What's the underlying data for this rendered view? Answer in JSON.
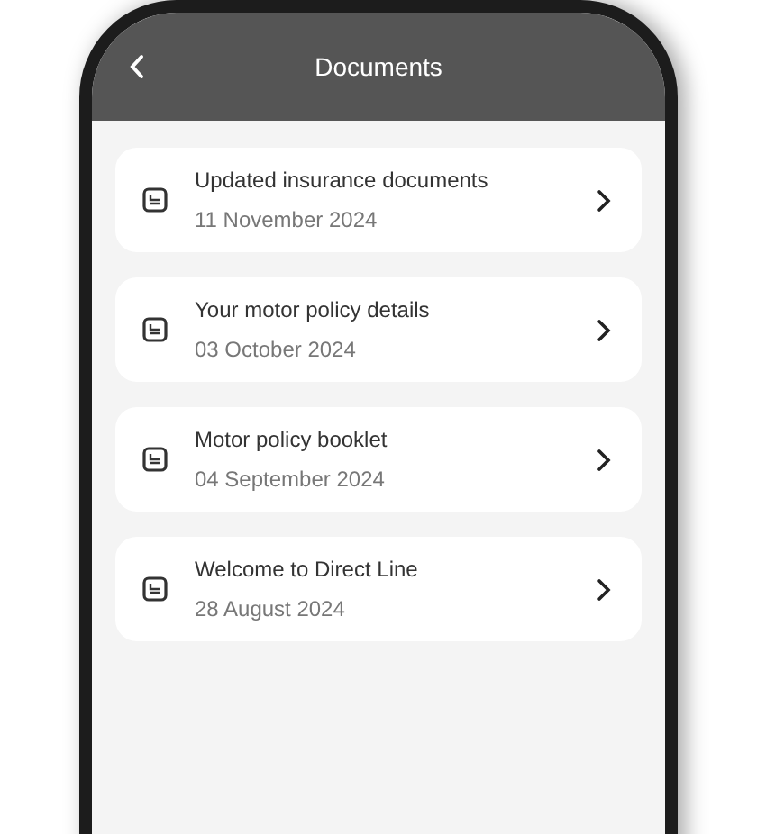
{
  "header": {
    "title": "Documents"
  },
  "documents": [
    {
      "title": "Updated insurance documents",
      "date": "11 November 2024"
    },
    {
      "title": "Your motor policy details",
      "date": "03 October 2024"
    },
    {
      "title": "Motor policy booklet",
      "date": "04 September 2024"
    },
    {
      "title": "Welcome to Direct Line",
      "date": "28 August 2024"
    }
  ]
}
